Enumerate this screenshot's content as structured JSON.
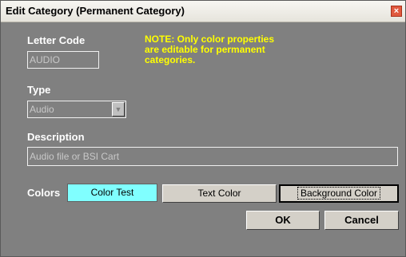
{
  "window": {
    "title": "Edit Category (Permanent Category)",
    "close_glyph": "×"
  },
  "form": {
    "letter_code_label": "Letter Code",
    "letter_code_value": "AUDIO",
    "note_line1": "NOTE: Only color properties",
    "note_line2": "are editable for permanent",
    "note_line3": "categories.",
    "type_label": "Type",
    "type_value": "Audio",
    "description_label": "Description",
    "description_value": "Audio file or BSI Cart",
    "colors_label": "Colors",
    "color_test_text": "Color Test",
    "color_test_bg": "#80ffff"
  },
  "buttons": {
    "text_color": "Text Color",
    "background_color": "Background Color",
    "ok": "OK",
    "cancel": "Cancel"
  },
  "icons": {
    "dropdown": "chevron-down-icon",
    "close": "close-icon"
  }
}
